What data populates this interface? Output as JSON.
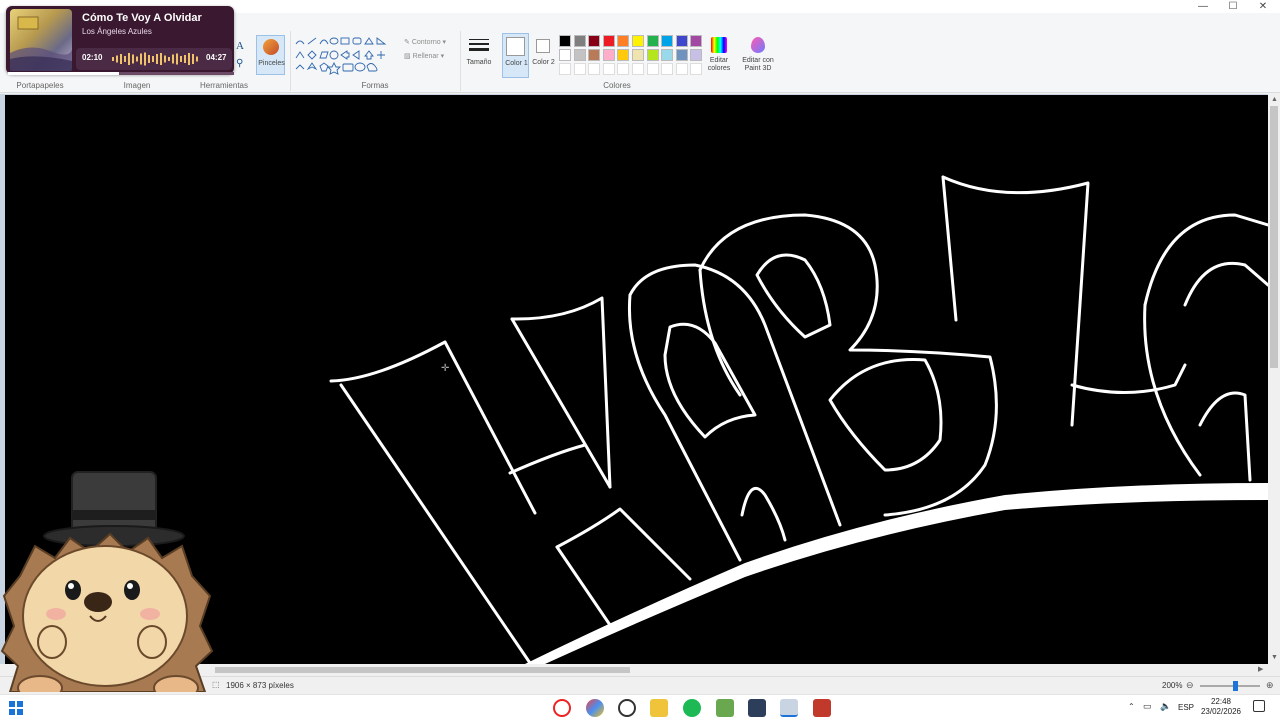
{
  "window": {
    "minimize": "—",
    "maximize": "☐",
    "close": "✕"
  },
  "ribbon": {
    "groups": {
      "clipboard": "Portapapeles",
      "image": "Imagen",
      "tools": "Herramientas",
      "shapes": "Formas",
      "colors": "Colores"
    },
    "brushes_label": "Pinceles",
    "outline_label": "Contorno",
    "fill_label": "Rellenar",
    "size_label": "Tamaño",
    "color1_label": "Color 1",
    "color2_label": "Color 2",
    "edit_colors_label": "Editar colores",
    "edit_paint3d_label": "Editar con Paint 3D",
    "palette_row1": [
      "#000000",
      "#7f7f7f",
      "#880015",
      "#ed1c24",
      "#ff7f27",
      "#fff200",
      "#22b14c",
      "#00a2e8",
      "#3f48cc",
      "#a349a4"
    ],
    "palette_row2": [
      "#ffffff",
      "#c3c3c3",
      "#b97a57",
      "#ffaec9",
      "#ffc90e",
      "#efe4b0",
      "#b5e61d",
      "#99d9ea",
      "#7092be",
      "#c8bfe7"
    ]
  },
  "music": {
    "title": "Cómo Te Voy A Olvidar",
    "artist": "Los Ángeles Azules",
    "elapsed": "02:10",
    "duration": "04:27",
    "progress": 0.49
  },
  "status": {
    "size": "1906 × 873 píxeles",
    "zoom": "200%"
  },
  "taskbar": {
    "lang": "ESP",
    "time": "22:48",
    "date": "23/02/2026"
  }
}
